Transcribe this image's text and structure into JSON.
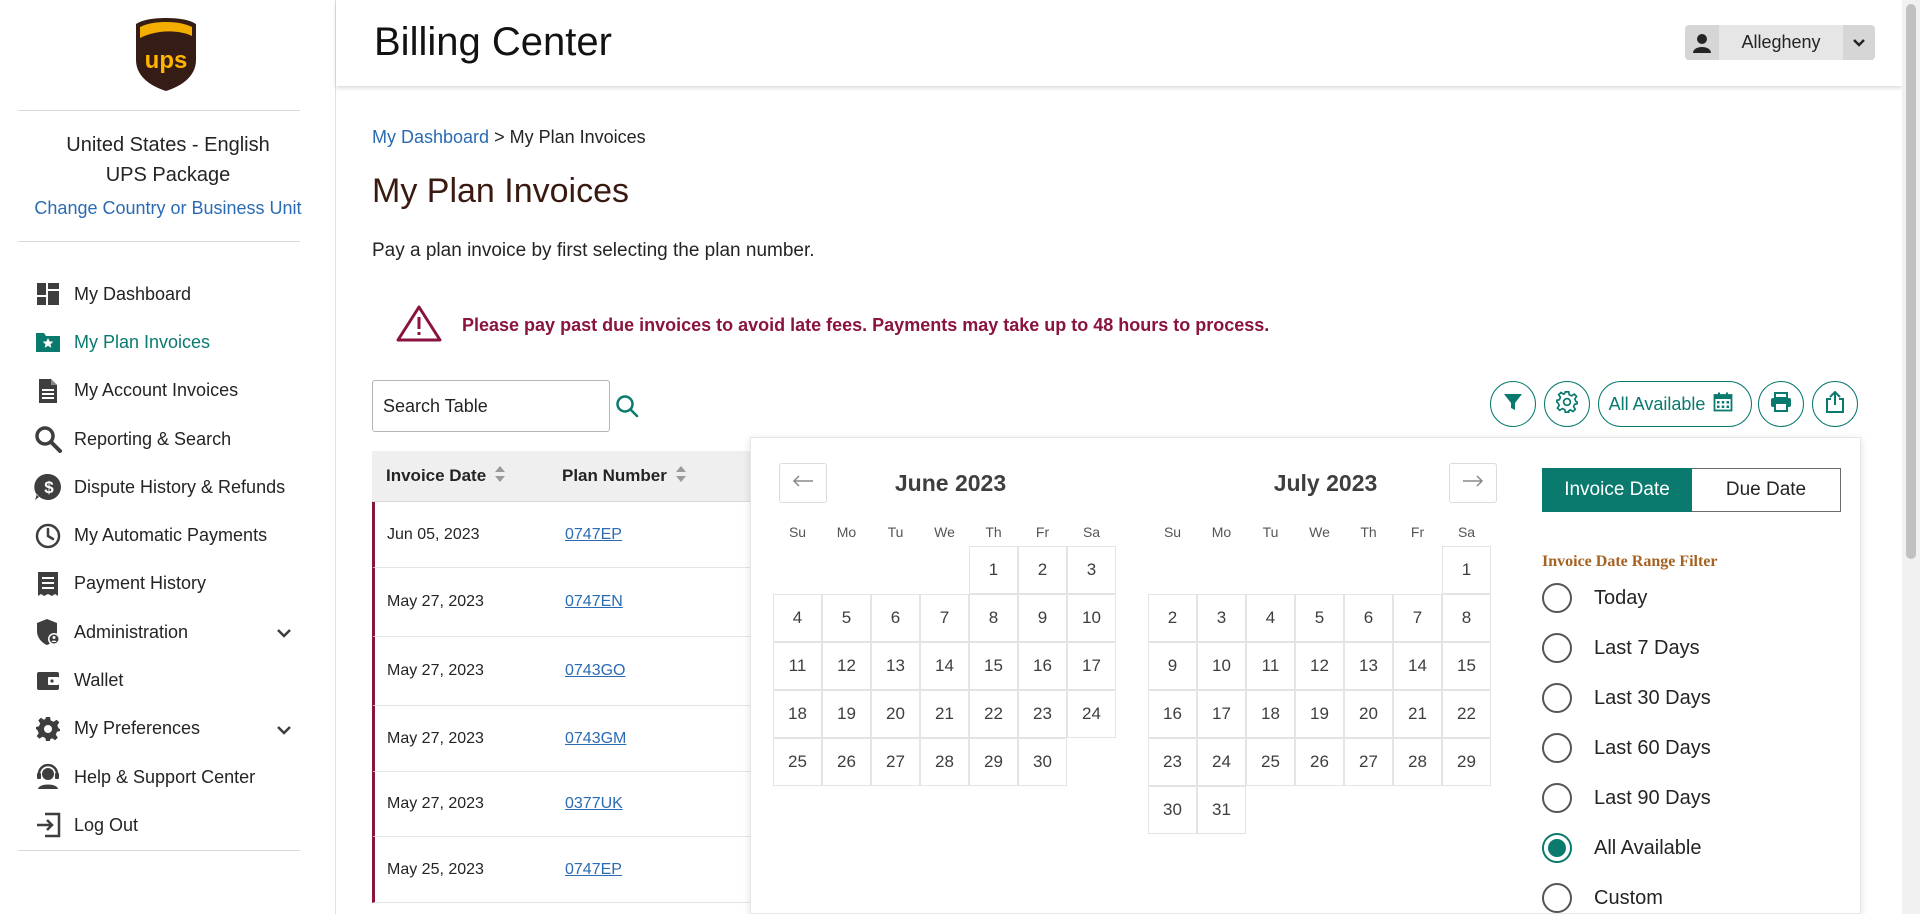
{
  "header": {
    "title": "Billing Center",
    "user_name": "Allegheny"
  },
  "sidebar": {
    "locale_line1": "United States - English",
    "locale_line2": "UPS Package",
    "change_link": "Change Country or Business Unit",
    "items": [
      {
        "label": "My Dashboard",
        "icon": "dashboard-icon"
      },
      {
        "label": "My Plan Invoices",
        "icon": "plan-invoice-icon",
        "active": true
      },
      {
        "label": "My Account Invoices",
        "icon": "document-icon"
      },
      {
        "label": "Reporting & Search",
        "icon": "search-icon"
      },
      {
        "label": "Dispute History & Refunds",
        "icon": "dollar-icon"
      },
      {
        "label": "My Automatic Payments",
        "icon": "clock-icon"
      },
      {
        "label": "Payment History",
        "icon": "receipt-icon"
      },
      {
        "label": "Administration",
        "icon": "admin-shield-icon",
        "expandable": true
      },
      {
        "label": "Wallet",
        "icon": "wallet-icon"
      },
      {
        "label": "My Preferences",
        "icon": "gear-icon",
        "expandable": true
      },
      {
        "label": "Help & Support Center",
        "icon": "support-agent-icon"
      },
      {
        "label": "Log Out",
        "icon": "logout-icon"
      }
    ]
  },
  "breadcrumb": {
    "parent": "My Dashboard",
    "separator": ">",
    "current": "My Plan Invoices"
  },
  "page": {
    "title": "My Plan Invoices",
    "subtitle": "Pay a plan invoice by first selecting the plan number.",
    "alert": "Please pay past due invoices to avoid late fees. Payments may take up to 48 hours to process."
  },
  "search": {
    "placeholder": "Search Table"
  },
  "toolbar": {
    "date_filter_label": "All Available"
  },
  "table": {
    "columns": [
      "Invoice Date",
      "Plan Number"
    ],
    "rows": [
      {
        "date": "Jun 05, 2023",
        "plan": "0747EP"
      },
      {
        "date": "May 27, 2023",
        "plan": "0747EN"
      },
      {
        "date": "May 27, 2023",
        "plan": "0743GO"
      },
      {
        "date": "May 27, 2023",
        "plan": "0743GM"
      },
      {
        "date": "May 27, 2023",
        "plan": "0377UK"
      },
      {
        "date": "May 25, 2023",
        "plan": "0747EP"
      }
    ]
  },
  "calendar": {
    "weekdays": [
      "Su",
      "Mo",
      "Tu",
      "We",
      "Th",
      "Fr",
      "Sa"
    ],
    "months": [
      {
        "title": "June 2023",
        "first_weekday": 4,
        "days": 30
      },
      {
        "title": "July 2023",
        "first_weekday": 6,
        "days": 31
      }
    ],
    "tabs": [
      "Invoice Date",
      "Due Date"
    ],
    "active_tab": "Invoice Date",
    "range_title": "Invoice Date Range Filter",
    "options": [
      "Today",
      "Last 7 Days",
      "Last 30 Days",
      "Last 60 Days",
      "Last 90 Days",
      "All Available",
      "Custom"
    ],
    "selected_option": "All Available"
  },
  "colors": {
    "accent": "#0a7a6f",
    "alert": "#8a1340",
    "link": "#2a6bb3",
    "brand_brown": "#351c15",
    "brand_gold": "#ffb500"
  }
}
